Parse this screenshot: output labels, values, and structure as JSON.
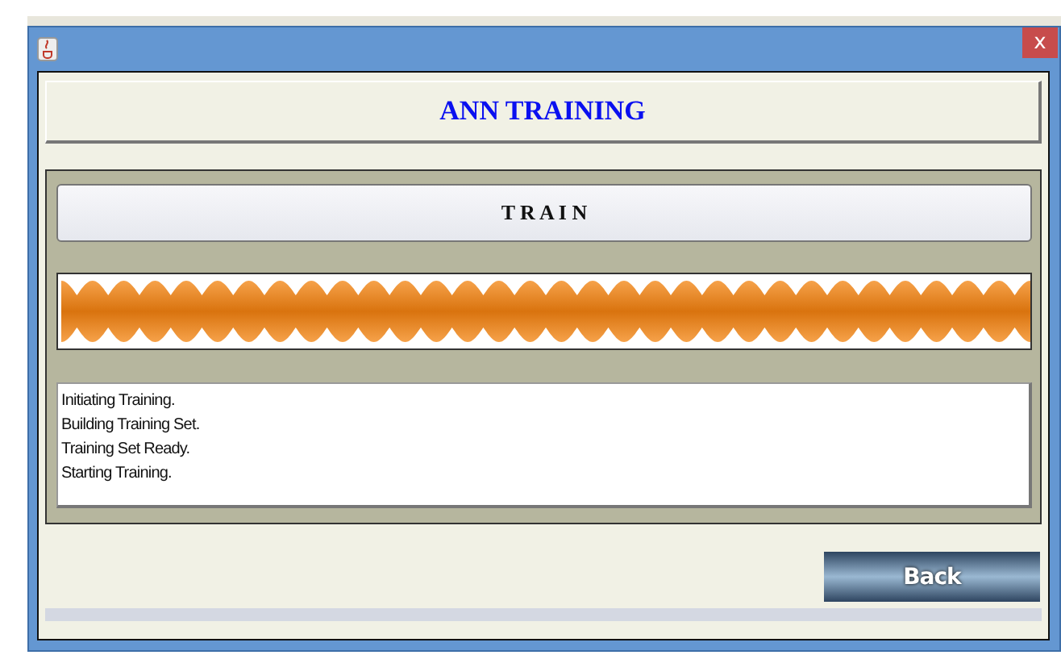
{
  "window": {
    "close": "x"
  },
  "progress": {
    "level": 1
  },
  "header": {
    "title": "ANN TRAINING"
  },
  "train_button": {
    "label": "T R A I N"
  },
  "log": {
    "lines": [
      "Initiating Training.",
      "Building Training Set.",
      "Training Set Ready.",
      "Starting Training."
    ]
  },
  "back_button": {
    "label": "Back"
  }
}
